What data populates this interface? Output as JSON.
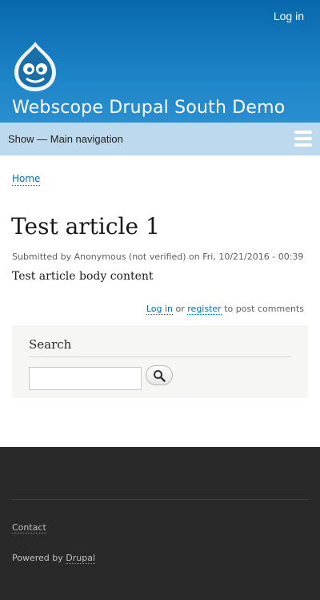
{
  "header": {
    "login_label": "Log in",
    "site_name": "Webscope Drupal South Demo",
    "logo_icon": "drupal-drop-logo"
  },
  "nav": {
    "toggle_label": "Show — Main navigation",
    "menu_icon": "hamburger-icon"
  },
  "breadcrumb": {
    "home_label": "Home"
  },
  "article": {
    "title": "Test article 1",
    "submitted": "Submitted by Anonymous (not verified) on Fri, 10/21/2016 - 00:39",
    "body": "Test article body content",
    "comment_login_label": "Log in",
    "comment_or": "or",
    "comment_register_label": "register",
    "comment_suffix": "to post comments"
  },
  "search": {
    "title": "Search",
    "input_value": "",
    "button_icon": "search-icon"
  },
  "footer": {
    "contact_label": "Contact",
    "powered_prefix": "Powered by",
    "powered_link": "Drupal"
  },
  "colors": {
    "header_blue": "#0868ac",
    "nav_bar": "#bdd9ee",
    "link": "#0071b3",
    "footer_bg": "#292929"
  }
}
